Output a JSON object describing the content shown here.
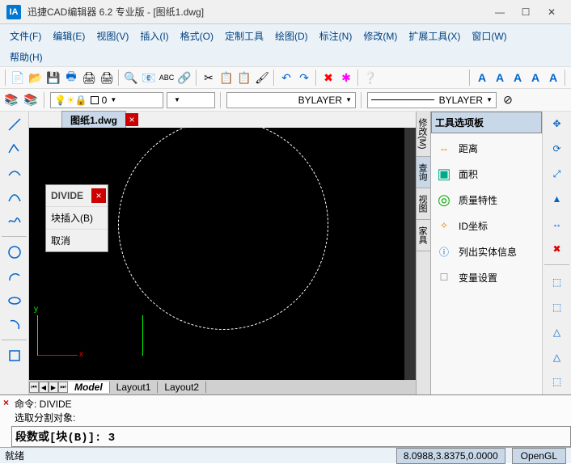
{
  "title": "迅捷CAD编辑器 6.2 专业版  - [图纸1.dwg]",
  "menubar": [
    "文件(F)",
    "编辑(E)",
    "视图(V)",
    "插入(I)",
    "格式(O)",
    "定制工具",
    "绘图(D)",
    "标注(N)",
    "修改(M)",
    "扩展工具(X)",
    "窗口(W)"
  ],
  "menubar2": [
    "帮助(H)"
  ],
  "layer": {
    "combo1": "0",
    "combo2": "",
    "linetype": "BYLAYER",
    "linetype2": "BYLAYER"
  },
  "tab": {
    "name": "图纸1.dwg",
    "close": "×"
  },
  "popup": {
    "title": "DIVIDE",
    "close": "×",
    "items": [
      "块插入(B)",
      "取消"
    ]
  },
  "axis": {
    "x": "x",
    "y": "y"
  },
  "layout_tabs": {
    "model": "Model",
    "l1": "Layout1",
    "l2": "Layout2"
  },
  "panel": {
    "title": "工具选项板",
    "items": [
      {
        "icon": "↔",
        "color": "#e67e00",
        "label": "距离"
      },
      {
        "icon": "▣",
        "color": "#0a8",
        "label": "面积"
      },
      {
        "icon": "◎",
        "color": "#0a0",
        "label": "质量特性"
      },
      {
        "icon": "✧",
        "color": "#e67e00",
        "label": "ID坐标"
      },
      {
        "icon": "ⓘ",
        "color": "#06c",
        "label": "列出实体信息"
      },
      {
        "icon": "☐",
        "color": "#888",
        "label": "变量设置"
      }
    ]
  },
  "vtabs": [
    "修改(M)",
    "查询",
    "视图",
    "家具"
  ],
  "cmd": {
    "line1": "命令:  DIVIDE",
    "line2": "选取分割对象:",
    "line3": "段数或[块(B)]: 3",
    "x": "×"
  },
  "status": {
    "label": "就绪",
    "coord": "8.0988,3.8375,0.0000",
    "gl": "OpenGL"
  },
  "font_icons": [
    "A",
    "A",
    "A",
    "A",
    "A"
  ]
}
